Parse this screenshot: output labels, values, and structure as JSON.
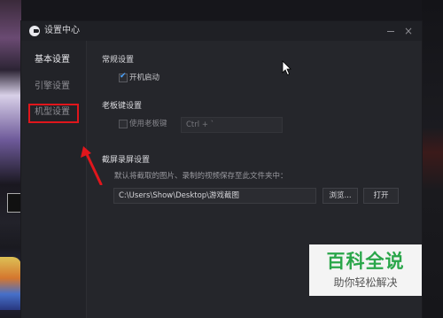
{
  "window": {
    "title": "设置中心",
    "close_label": "×"
  },
  "sidebar": {
    "items": [
      {
        "label": "基本设置",
        "active": true
      },
      {
        "label": "引擎设置",
        "active": false
      },
      {
        "label": "机型设置",
        "active": false,
        "highlighted": true
      }
    ]
  },
  "general": {
    "title": "常规设置",
    "autostart_label": "开机启动",
    "autostart_checked": true
  },
  "boss_key": {
    "title": "老板键设置",
    "enable_label": "使用老板键",
    "enable_checked": false,
    "hotkey_value": "Ctrl + `"
  },
  "screenshot": {
    "title": "截屏录屏设置",
    "description": "默认将截取的图片、录制的视频保存至此文件夹中：",
    "path_value": "C:\\Users\\Show\\Desktop\\游戏截图",
    "browse_label": "浏览...",
    "open_label": "打开"
  },
  "watermark": {
    "title": "百科全说",
    "subtitle": "助你轻松解决"
  },
  "colors": {
    "accent": "#4aa3ff",
    "highlight_red": "#e0161c",
    "watermark_green": "#2aa64a"
  }
}
